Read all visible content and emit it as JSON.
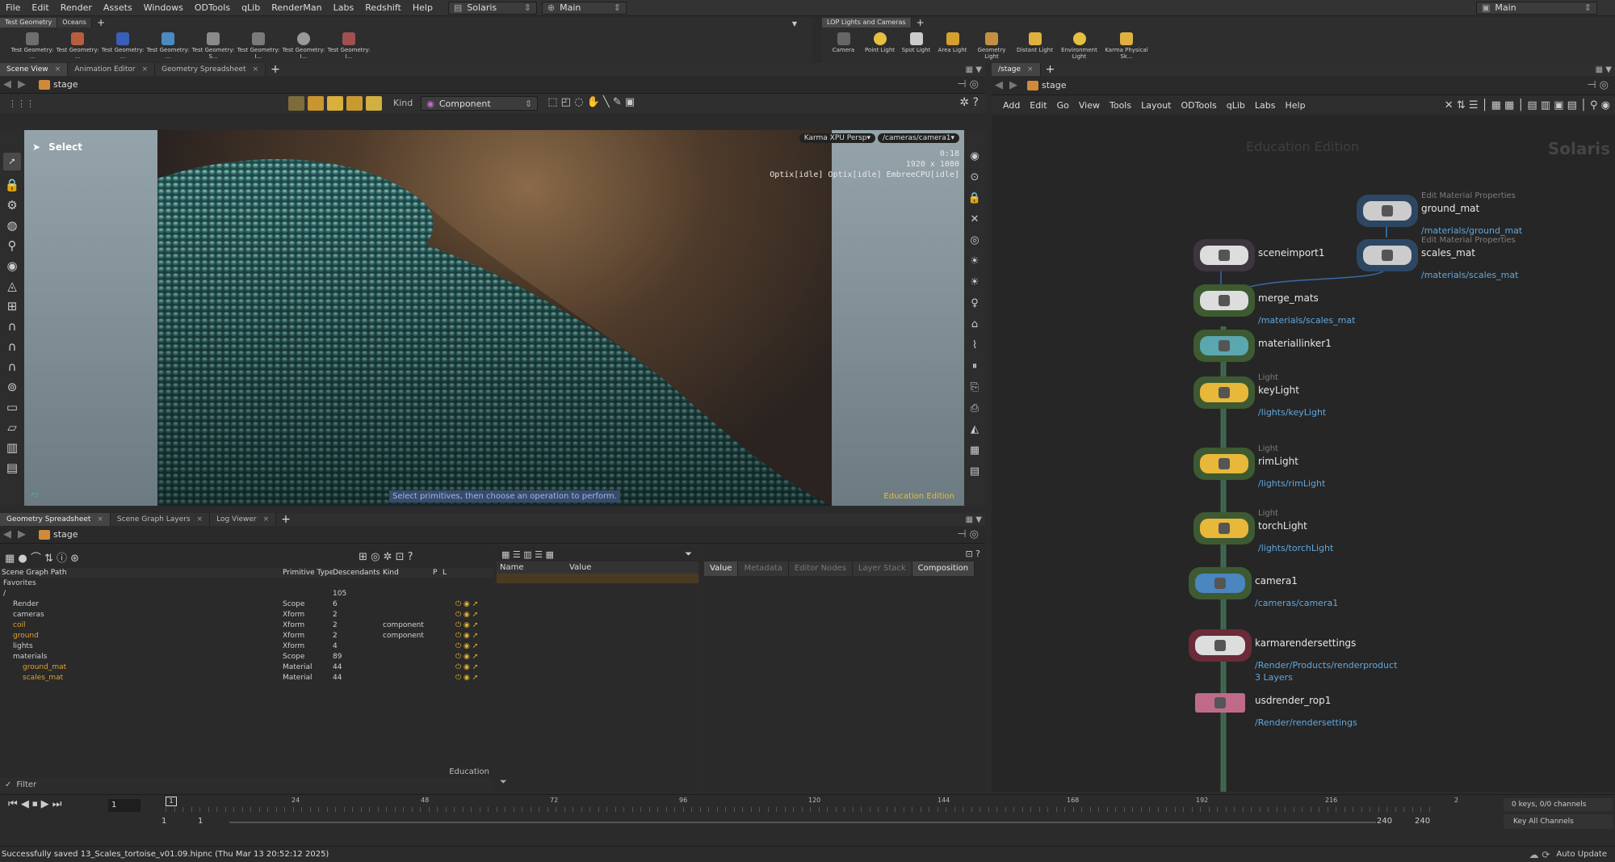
{
  "menubar": {
    "items": [
      "File",
      "Edit",
      "Render",
      "Assets",
      "Windows",
      "ODTools",
      "qLib",
      "RenderMan",
      "Labs",
      "Redshift",
      "Help"
    ],
    "desktop": "Solaris",
    "context": "Main",
    "main_right": "Main"
  },
  "shelf_left": {
    "tabs": [
      "Test Geometry",
      "Oceans"
    ],
    "tools": [
      "Test Geometry: ...",
      "Test Geometry: ...",
      "Test Geometry: ...",
      "Test Geometry: ...",
      "Test Geometry: S...",
      "Test Geometry: I...",
      "Test Geometry: I...",
      "Test Geometry: I..."
    ]
  },
  "shelf_right": {
    "tabs": [
      "LOP Lights and Cameras"
    ],
    "tools": [
      "Camera",
      "Point Light",
      "Spot Light",
      "Area Light",
      "Geometry Light",
      "Distant Light",
      "Environment Light",
      "Karma Physical Sk..."
    ]
  },
  "viewer": {
    "tabs": [
      "Scene View",
      "Animation Editor",
      "Geometry Spreadsheet"
    ],
    "path": "stage",
    "kind_label": "Kind",
    "kind_value": "Component",
    "select_label": "Select",
    "renderer": "Karma XPU",
    "persp": "Persp",
    "camera": "/cameras/camera1",
    "render_time": "0:18",
    "resolution": "1920 x 1080",
    "status_line": "Optix[idle] Optix[idle] EmbreeCPU[idle]",
    "hint": "Select primitives, then choose an operation to perform.",
    "edition": "Education Edition"
  },
  "lower_left": {
    "tabs": [
      "Geometry Spreadsheet",
      "Scene Graph Layers",
      "Log Viewer"
    ],
    "path": "stage",
    "columns": [
      "Scene Graph Path",
      "Primitive Type",
      "Descendants",
      "Kind",
      "P",
      "L"
    ],
    "rows": [
      {
        "name": "Favorites",
        "type": "",
        "desc": "",
        "kind": "",
        "color": "#cfcfcf",
        "indent": 0
      },
      {
        "name": "/",
        "type": "",
        "desc": "105",
        "kind": "",
        "color": "#cfcfcf",
        "indent": 0
      },
      {
        "name": "Render",
        "type": "Scope",
        "desc": "6",
        "kind": "",
        "color": "#cfcfcf",
        "indent": 1
      },
      {
        "name": "cameras",
        "type": "Xform",
        "desc": "2",
        "kind": "",
        "color": "#cfcfcf",
        "indent": 1
      },
      {
        "name": "coil",
        "type": "Xform",
        "desc": "2",
        "kind": "component",
        "color": "#e0a030",
        "indent": 1
      },
      {
        "name": "ground",
        "type": "Xform",
        "desc": "2",
        "kind": "component",
        "color": "#e0a030",
        "indent": 1
      },
      {
        "name": "lights",
        "type": "Xform",
        "desc": "4",
        "kind": "",
        "color": "#cfcfcf",
        "indent": 1
      },
      {
        "name": "materials",
        "type": "Scope",
        "desc": "89",
        "kind": "",
        "color": "#cfcfcf",
        "indent": 1
      },
      {
        "name": "ground_mat",
        "type": "Material",
        "desc": "44",
        "kind": "",
        "color": "#e0a030",
        "indent": 2
      },
      {
        "name": "scales_mat",
        "type": "Material",
        "desc": "44",
        "kind": "",
        "color": "#e0a030",
        "indent": 2
      }
    ],
    "edition": "Education",
    "filter": "Filter"
  },
  "lower_mid": {
    "columns": [
      "Name",
      "Value"
    ]
  },
  "lower_right": {
    "tabs": [
      "Value",
      "Metadata",
      "Editor Nodes",
      "Layer Stack",
      "Composition"
    ]
  },
  "network": {
    "tab": "/stage",
    "path": "stage",
    "menu": [
      "Add",
      "Edit",
      "Go",
      "View",
      "Tools",
      "Layout",
      "ODTools",
      "qLib",
      "Labs",
      "Help"
    ],
    "watermark_edition": "Education Edition",
    "watermark_context": "Solaris",
    "nodes": {
      "ground_mat": {
        "cat": "Edit Material Properties",
        "name": "ground_mat",
        "sub": "/materials/ground_mat"
      },
      "scales_mat": {
        "cat": "Edit Material Properties",
        "name": "scales_mat",
        "sub": "/materials/scales_mat"
      },
      "sceneimport1": {
        "name": "sceneimport1"
      },
      "merge_mats": {
        "name": "merge_mats",
        "sub": "/materials/scales_mat"
      },
      "materiallinker1": {
        "name": "materiallinker1"
      },
      "keyLight": {
        "cat": "Light",
        "name": "keyLight",
        "sub": "/lights/keyLight"
      },
      "rimLight": {
        "cat": "Light",
        "name": "rimLight",
        "sub": "/lights/rimLight"
      },
      "torchLight": {
        "cat": "Light",
        "name": "torchLight",
        "sub": "/lights/torchLight"
      },
      "camera1": {
        "name": "camera1",
        "sub": "/cameras/camera1"
      },
      "karmarendersettings": {
        "name": "karmarendersettings",
        "sub": "/Render/Products/renderproduct",
        "sub2": "3 Layers"
      },
      "usdrender_rop1": {
        "name": "usdrender_rop1",
        "sub": "/Render/rendersettings"
      }
    }
  },
  "timeline": {
    "frame": "1",
    "ticks": [
      "24",
      "48",
      "72",
      "96",
      "120",
      "144",
      "168",
      "192",
      "216",
      "2"
    ],
    "start": "1",
    "start2": "1",
    "end": "240",
    "end2": "240",
    "keys": "0 keys, 0/0 channels",
    "key_all": "Key All Channels"
  },
  "status": {
    "message": "Successfully saved 13_Scales_tortoise_v01.09.hipnc (Thu Mar 13 20:52:12 2025)",
    "auto_update": "Auto Update"
  }
}
